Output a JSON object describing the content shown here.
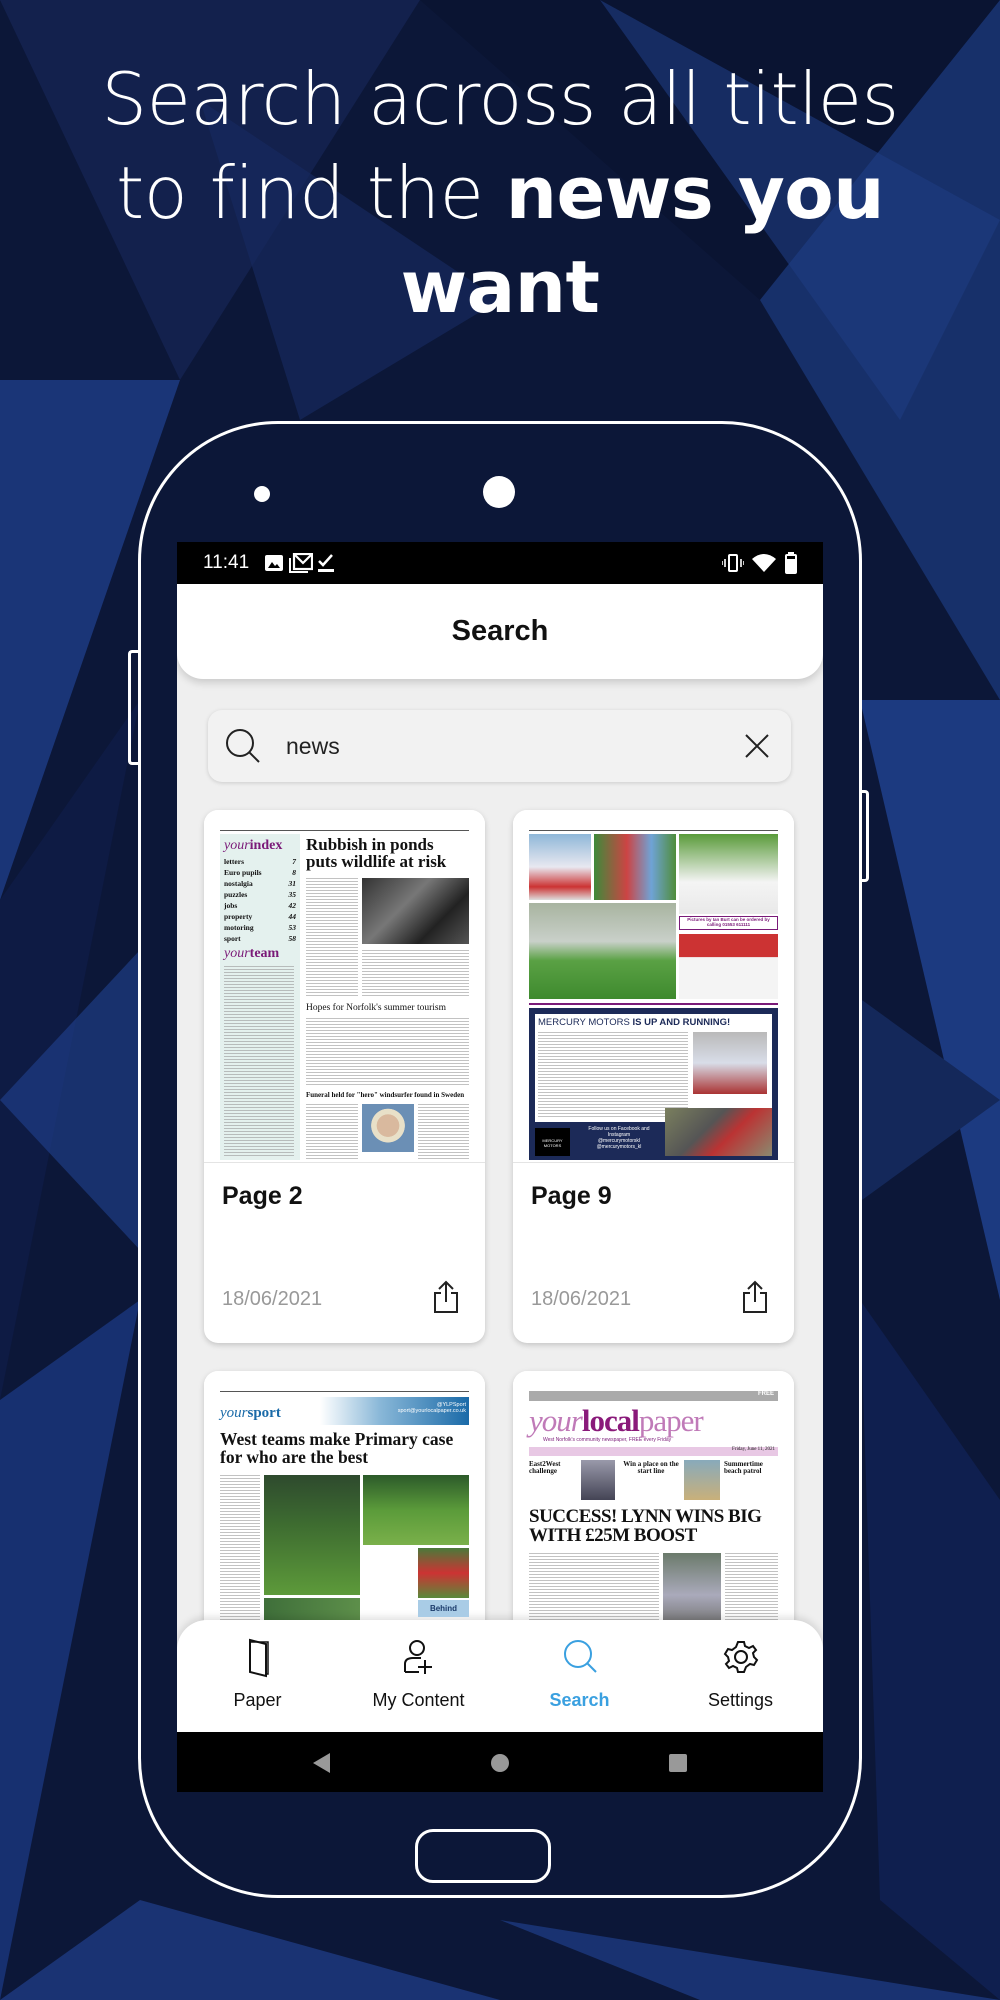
{
  "promo": {
    "line1": "Search across all titles",
    "line2_light": "to find the ",
    "line2_bold": "news you",
    "line3_bold": "want"
  },
  "status_bar": {
    "time": "11:41",
    "icons": [
      "image-icon",
      "gmail-icon",
      "check-icon",
      "vibrate-icon",
      "wifi-icon",
      "battery-icon"
    ]
  },
  "header": {
    "title": "Search"
  },
  "search": {
    "value": "news",
    "placeholder": ""
  },
  "results": [
    {
      "label": "Page 2",
      "date": "18/06/2021",
      "thumb": {
        "index_title_a": "your",
        "index_title_b": "index",
        "index_items": [
          [
            "letters",
            "7"
          ],
          [
            "Euro pupils",
            "8"
          ],
          [
            "nostalgia",
            "31"
          ],
          [
            "puzzles",
            "35"
          ],
          [
            "jobs",
            "42"
          ],
          [
            "property",
            "44"
          ],
          [
            "motoring",
            "53"
          ],
          [
            "sport",
            "58"
          ]
        ],
        "team_title_a": "your",
        "team_title_b": "team",
        "headline": "Rubbish in ponds puts wildlife at risk",
        "headline2": "Hopes for Norfolk's summer tourism",
        "headline3": "Funeral held for \"hero\" windsurfer found in Sweden"
      }
    },
    {
      "label": "Page 9",
      "date": "18/06/2021",
      "thumb": {
        "caption": "Pictures by Ian Burt can be ordered by calling 01553 611111",
        "ad_title_a": "MERCURY MOTORS ",
        "ad_title_b": "IS UP AND RUNNING!",
        "ad_follow": "Follow us on Facebook and Instagram",
        "ad_handle1": "@mercurymotorskl",
        "ad_handle2": "@mercurymotors_kl",
        "ad_logo": "MERCURY MOTORS"
      }
    },
    {
      "label": "",
      "date": "",
      "thumb": {
        "section_a": "your",
        "section_b": "sport",
        "twitter": "@YLPSport",
        "email": "sport@yourlocalpaper.co.uk",
        "headline": "West teams make Primary case for who are the best",
        "box": "Behind"
      }
    },
    {
      "label": "",
      "date": "",
      "thumb": {
        "free": "FREE",
        "mast_a": "your",
        "mast_b": "local",
        "mast_c": "paper",
        "tagline": "West Norfolk's community newspaper, FREE every Friday",
        "dateline": "Friday, June 11, 2021",
        "teaser1": "East2West challenge",
        "teaser2": "Win a place on the start line",
        "teaser3": "Summertime beach patrol",
        "headline": "SUCCESS! LYNN WINS BIG WITH £25M BOOST"
      }
    }
  ],
  "nav": [
    {
      "label": "Paper",
      "icon": "paper-icon"
    },
    {
      "label": "My Content",
      "icon": "add-user-icon"
    },
    {
      "label": "Search",
      "icon": "search-icon",
      "active": true
    },
    {
      "label": "Settings",
      "icon": "gear-icon"
    }
  ],
  "colors": {
    "accent": "#3aa0e0",
    "background": "#0d1a3e",
    "brand_purple": "#8a1a7a"
  }
}
